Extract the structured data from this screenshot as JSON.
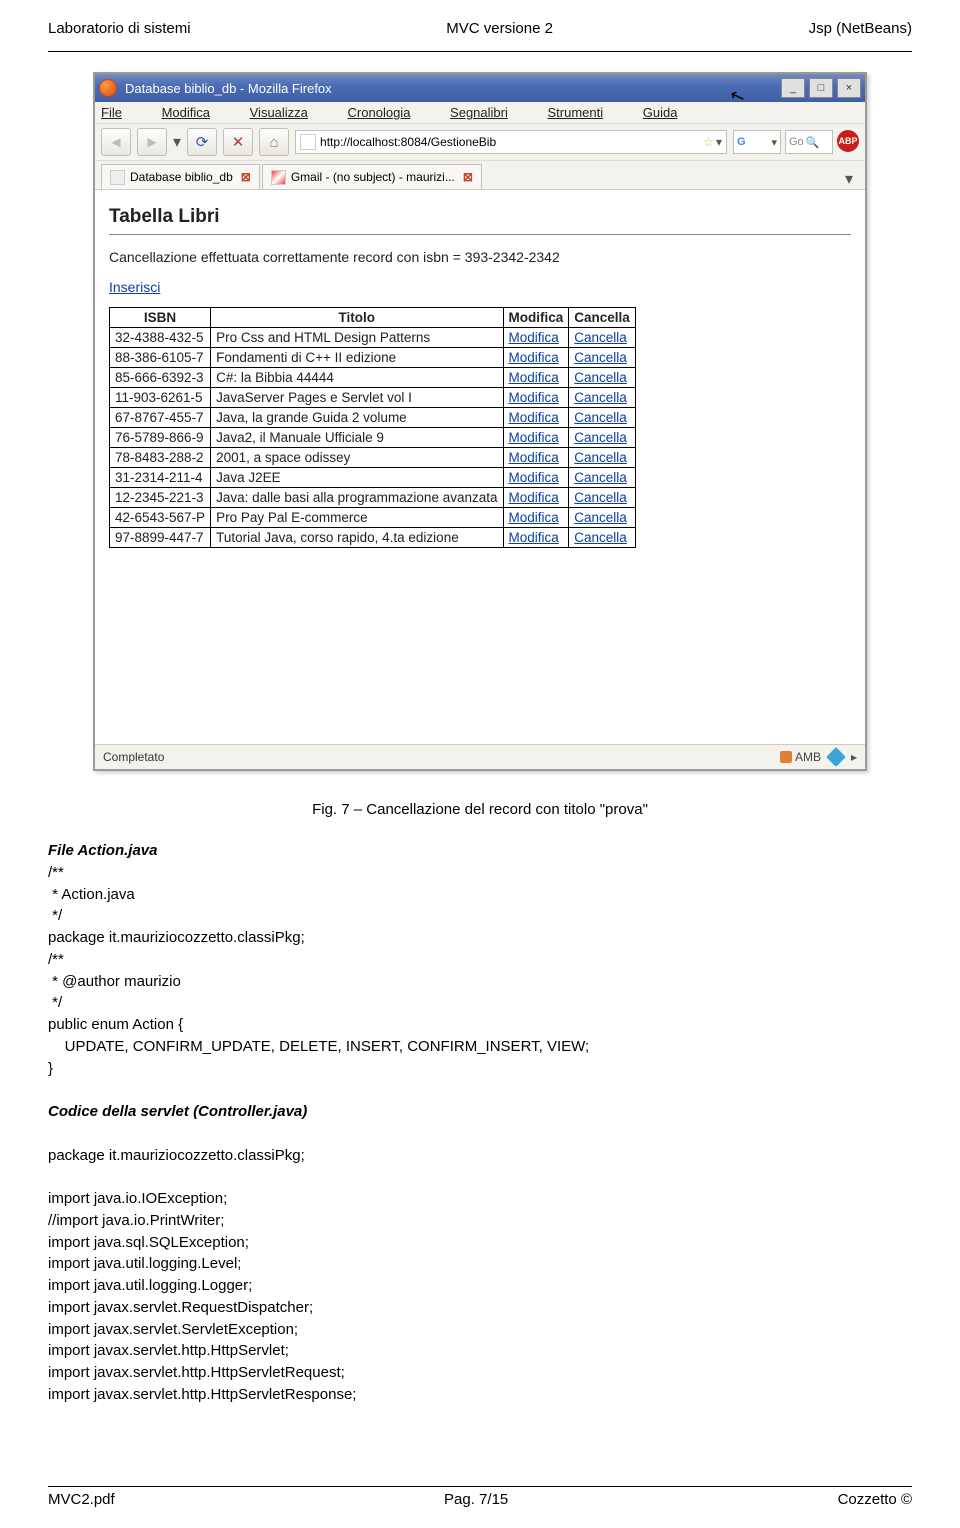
{
  "doc": {
    "header_left": "Laboratorio di sistemi",
    "header_center": "MVC versione 2",
    "header_right": "Jsp (NetBeans)",
    "footer_left": "MVC2.pdf",
    "footer_center": "Pag. 7/15",
    "footer_right": "Cozzetto ©"
  },
  "browser": {
    "title": "Database biblio_db - Mozilla Firefox",
    "menu": [
      "File",
      "Modifica",
      "Visualizza",
      "Cronologia",
      "Segnalibri",
      "Strumenti",
      "Guida"
    ],
    "url": "http://localhost:8084/GestioneBib",
    "search1_placeholder": "G",
    "search2_placeholder": "Go",
    "tabs": [
      {
        "label": "Database biblio_db"
      },
      {
        "label": "Gmail - (no subject) - maurizi..."
      }
    ],
    "status": "Completato",
    "status_right": "AMB"
  },
  "page": {
    "heading": "Tabella Libri",
    "message": "Cancellazione effettuata correttamente record con isbn = 393-2342-2342",
    "insert_link": "Inserisci",
    "columns": [
      "ISBN",
      "Titolo",
      "Modifica",
      "Cancella"
    ],
    "modifica": "Modifica",
    "cancella": "Cancella",
    "rows": [
      {
        "isbn": "32-4388-432-5",
        "titolo": "Pro Css and HTML Design Patterns"
      },
      {
        "isbn": "88-386-6105-7",
        "titolo": "Fondamenti di C++ II edizione"
      },
      {
        "isbn": "85-666-6392-3",
        "titolo": "C#: la Bibbia 44444"
      },
      {
        "isbn": "11-903-6261-5",
        "titolo": "JavaServer Pages e Servlet vol I"
      },
      {
        "isbn": "67-8767-455-7",
        "titolo": "Java, la grande Guida 2 volume"
      },
      {
        "isbn": "76-5789-866-9",
        "titolo": "Java2, il Manuale Ufficiale 9"
      },
      {
        "isbn": "78-8483-288-2",
        "titolo": "2001, a space odissey"
      },
      {
        "isbn": "31-2314-211-4",
        "titolo": "Java J2EE"
      },
      {
        "isbn": "12-2345-221-3",
        "titolo": "Java: dalle basi alla programmazione avanzata"
      },
      {
        "isbn": "42-6543-567-P",
        "titolo": "Pro Pay Pal E-commerce"
      },
      {
        "isbn": "97-8899-447-7",
        "titolo": "Tutorial Java, corso rapido, 4.ta edizione"
      }
    ]
  },
  "caption": "Fig. 7 – Cancellazione del record con titolo \"prova\"",
  "code": {
    "heading1": "File Action.java",
    "block1": "/**\n * Action.java\n */\npackage it.mauriziocozzetto.classiPkg;\n/**\n * @author maurizio\n */\npublic enum Action {\n    UPDATE, CONFIRM_UPDATE, DELETE, INSERT, CONFIRM_INSERT, VIEW;\n}",
    "heading2": "Codice della servlet (Controller.java)",
    "block2": "package it.mauriziocozzetto.classiPkg;\n\nimport java.io.IOException;\n//import java.io.PrintWriter;\nimport java.sql.SQLException;\nimport java.util.logging.Level;\nimport java.util.logging.Logger;\nimport javax.servlet.RequestDispatcher;\nimport javax.servlet.ServletException;\nimport javax.servlet.http.HttpServlet;\nimport javax.servlet.http.HttpServletRequest;\nimport javax.servlet.http.HttpServletResponse;"
  }
}
